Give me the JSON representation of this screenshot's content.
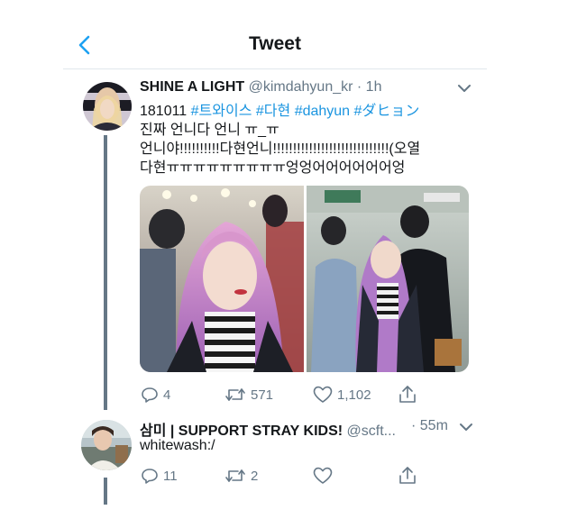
{
  "header": {
    "title": "Tweet"
  },
  "tweet": {
    "name": "SHINE A LIGHT",
    "handle": "@kimdahyun_kr",
    "time": "· 1h",
    "line1_prefix": "181011 ",
    "tags": [
      "#트와이스",
      "#다현",
      "#dahyun",
      "#ダヒョン"
    ],
    "line2": "진짜 언니다 언니 ㅠ_ㅠ",
    "line3": "언니야!!!!!!!!!!다현언니!!!!!!!!!!!!!!!!!!!!!!!!!!!!!(오열",
    "line4": "다현ㅠㅠㅠㅠㅠㅠㅠㅠㅠ엉엉어어어어어어엉",
    "replies": "4",
    "retweets": "571",
    "likes": "1,102",
    "icons": [
      "reply-icon",
      "retweet-icon",
      "heart-icon",
      "share-icon"
    ]
  },
  "reply": {
    "name": "삼미 | SUPPORT STRAY KIDS!",
    "handle": "@scft...",
    "time": "· 55m",
    "text": "whitewash:/",
    "replies": "11",
    "retweets": "2",
    "likes": ""
  },
  "colors": {
    "accent": "#1b95e0",
    "muted": "#657786",
    "thread": "#657786"
  }
}
